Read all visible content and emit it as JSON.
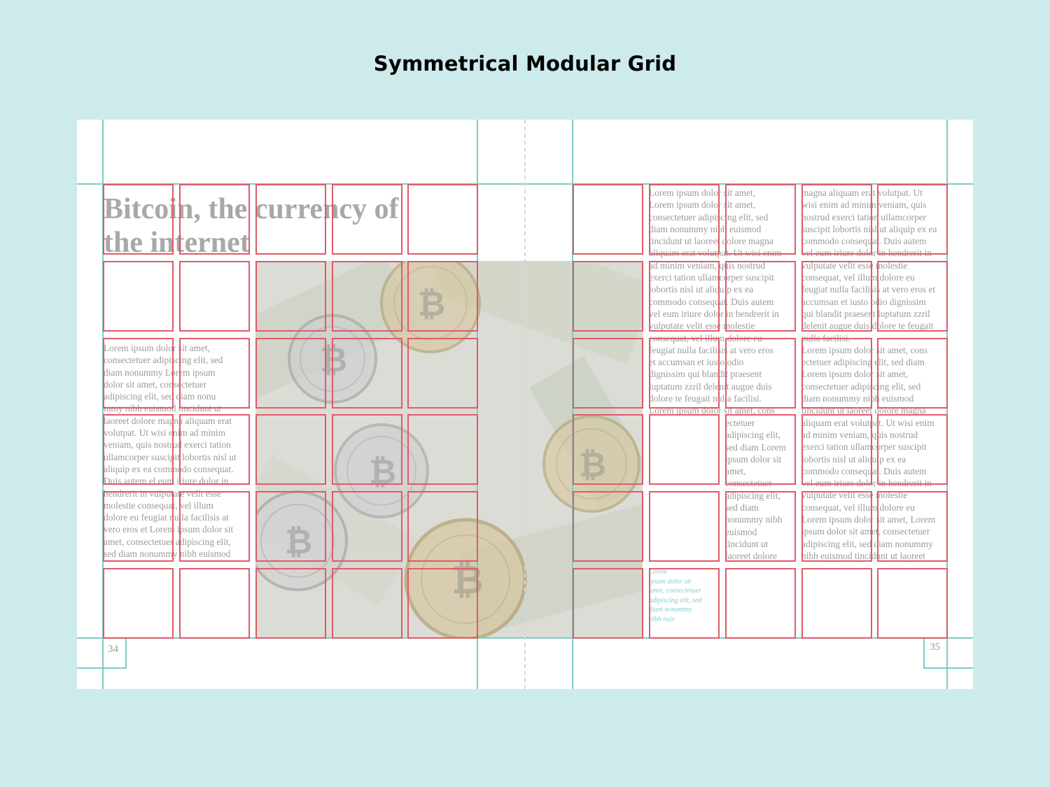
{
  "title": "Symmetrical Modular Grid",
  "headline": "Bitcoin, the currency of\nthe internet",
  "left_body": "Lorem ipsum dolor sit amet,\nconsectetuer adipiscing elit, sed\ndiam nonummy Lorem ipsum\ndolor sit amet, consectetuer\nadipiscing elit, sed diam nonu\nmmy nibh euismod tincidunt ut\nlaoreet dolore magna aliquam  erat\nvolutpat. Ut wisi enim ad minim\nveniam, quis nostrud exerci tation\nullamcorper suscipit lobortis nisl ut\naliquip ex ea commodo consequat.\nDuis autem el eum iriure dolor in\nhendrerit in vulputate velit esse\nmolestie consequat, vel illum\ndolore eu feugiat nulla facilisis at\nvero eros et Lorem ipsum dolor sit\namet, consectetuer adipiscing elit,\nsed diam nonummy nibh euismod",
  "right_col1": "Lorem ipsum dolor sit amet,\nLorem ipsum dolor sit amet,\nconsectetuer adipiscing elit, sed\ndiam nonummy nibh euismod\ntincidunt ut laoreet dolore magna\naliquam erat volutpat. Ut wisi enim\nad minim veniam, quis nostrud\nexerci tation ullamcorper suscipit\nlobortis nisl ut aliquip ex ea\ncommodo consequat. Duis autem\nvel eum iriure dolor in hendrerit in\nvulputate velit esse molestie\nconsequat, vel illum dolore eu\nfeugiat nulla facilisis at vero eros\net accumsan et iusto odio\ndignissim qui blandit praesent\nluptatum zzril delenit augue duis\ndolore te feugait nulla facilisi.\nLorem ipsum dolor sit amet, cons",
  "right_col1_cont": "ectetuer\nadipiscing elit,\nsed diam Lorem\nipsum dolor sit\namet,\nconsectetuer\nadipiscing elit,\nsed diam\nnonummy nibh\neuismod\ntincidunt ut\nlaoreet dolore",
  "right_col2": "magna aliquam erat volutpat. Ut\nwisi enim ad minim veniam, quis\nnostrud exerci tation ullamcorper\nsuscipit lobortis nisl ut aliquip ex ea\ncommodo consequat. Duis autem\nvel eum iriure dolor in hendrerit in\nvulputate velit esse molestie\nconsequat, vel illum dolore eu\nfeugiat nulla facilisis at vero eros et\naccumsan et iusto odio dignissim\nqui blandit praesent luptatum zzril\ndelenit augue duis dolore te feugait\nnulla facilisi.\nLorem ipsum dolor sit amet, cons\nectetuer adipiscing elit, sed diam\nLorem ipsum dolor sit amet,\nconsectetuer adipiscing elit, sed\ndiam nonummy nibh euismod\ntincidunt ut laoreet dolore magna\naliquam erat volutpat. Ut wisi enim\nad minim veniam, quis nostrud\nexerci tation ullamcorper suscipit\nlobortis nisl ut aliquip ex ea\ncommodo consequat. Duis autem\nvel eum iriure dolor in hendrerit in\nvulputate velit esse molestie\nconsequat, vel illum dolore eu\nLorem ipsum dolor sit amet, Lorem\nipsum dolor sit amet, consectetuer\nadipiscing elit, sed diam nonummy\nnibh euismod tincidunt ut laoreet",
  "caption": "Lorem\nipsum dolor sit\namet, consectetuer\nadipiscing elit, sed\ndiam nonummy\nnibh euis",
  "page_left": "34",
  "page_right": "35",
  "colors": {
    "background": "#cdebea",
    "page": "#ffffff",
    "guides": "#7cccc6",
    "modules": "#e05a68",
    "text": "#9a9a9a",
    "caption": "#7fd0cb"
  },
  "photo": "bitcoin coins on dollar bills"
}
